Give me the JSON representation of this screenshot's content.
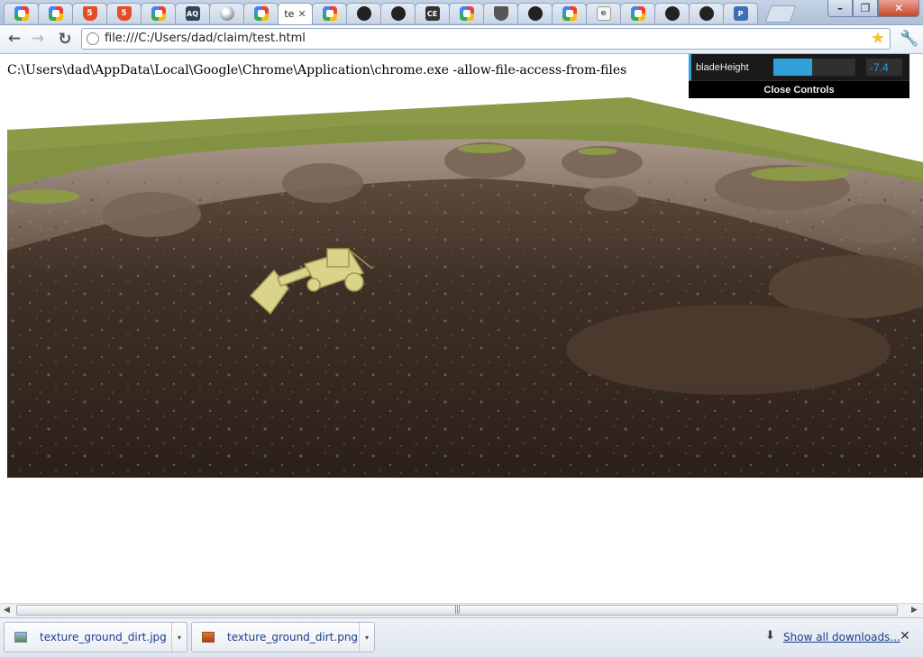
{
  "browser": {
    "tabs": [
      {
        "icon": "google-icon"
      },
      {
        "icon": "google-icon"
      },
      {
        "icon": "html5-icon"
      },
      {
        "icon": "html5-icon"
      },
      {
        "icon": "google-icon"
      },
      {
        "icon": "aq-icon"
      },
      {
        "icon": "globe-icon"
      },
      {
        "icon": "google-icon"
      },
      {
        "icon": "none",
        "title": "te",
        "active": true
      },
      {
        "icon": "google-icon"
      },
      {
        "icon": "github-icon"
      },
      {
        "icon": "github-icon"
      },
      {
        "icon": "ce-icon"
      },
      {
        "icon": "google-icon"
      },
      {
        "icon": "shield-icon"
      },
      {
        "icon": "github-icon"
      },
      {
        "icon": "google-icon"
      },
      {
        "icon": "page-icon"
      },
      {
        "icon": "google-icon"
      },
      {
        "icon": "github-icon"
      },
      {
        "icon": "github-icon"
      },
      {
        "icon": "p-icon"
      }
    ],
    "url": "file:///C:/Users/dad/claim/test.html"
  },
  "page": {
    "text": "C:\\Users\\dad\\AppData\\Local\\Google\\Chrome\\Application\\chrome.exe -allow-file-access-from-files"
  },
  "gui": {
    "label": "bladeHeight",
    "value": "-7.4",
    "fill_fraction": 0.47,
    "close_label": "Close Controls",
    "accent_color": "#2fa1d6"
  },
  "downloads": {
    "items": [
      {
        "name": "texture_ground_dirt.jpg",
        "icon": "image-file-icon"
      },
      {
        "name": "texture_ground_dirt.png",
        "icon": "image-file-icon"
      }
    ],
    "show_all": "Show all downloads..."
  }
}
